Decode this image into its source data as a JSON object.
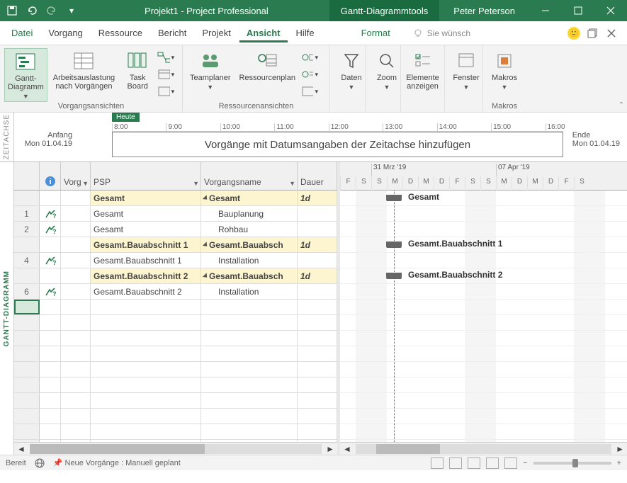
{
  "titlebar": {
    "title": "Projekt1  -  Project Professional",
    "tools": "Gantt-Diagrammtools",
    "user": "Peter Peterson"
  },
  "menu": {
    "file": "Datei",
    "vorgang": "Vorgang",
    "ressource": "Ressource",
    "bericht": "Bericht",
    "projekt": "Projekt",
    "ansicht": "Ansicht",
    "hilfe": "Hilfe",
    "format": "Format",
    "tellme": "Sie wünsch"
  },
  "ribbon": {
    "gantt": "Gantt-\nDiagramm",
    "arbeit": "Arbeitsauslastung\nnach Vorgängen",
    "task": "Task\nBoard",
    "group1": "Vorgangsansichten",
    "team": "Teamplaner",
    "resplan": "Ressourcenplan",
    "group2": "Ressourcenansichten",
    "daten": "Daten",
    "zoom": "Zoom",
    "elemente": "Elemente\nanzeigen",
    "fenster": "Fenster",
    "makros": "Makros",
    "group3": "Makros"
  },
  "timeline": {
    "heute": "Heute",
    "anfang": "Anfang",
    "anfang_date": "Mon 01.04.19",
    "ende": "Ende",
    "ende_date": "Mon 01.04.19",
    "prompt": "Vorgänge mit Datumsangaben der Zeitachse hinzufügen",
    "ticks": [
      "8:00",
      "9:00",
      "10:00",
      "11:00",
      "12:00",
      "13:00",
      "14:00",
      "15:00",
      "16:00"
    ]
  },
  "vtab_timeline": "ZEITACHSE",
  "vtab_gantt": "GANTT-DIAGRAMM",
  "columns": {
    "info": "",
    "vorg": "Vorg",
    "psp": "PSP",
    "name": "Vorgangsname",
    "dauer": "Dauer"
  },
  "rows": [
    {
      "num": "",
      "summary": true,
      "psp": "Gesamt",
      "name": "Gesamt",
      "dauer": "1d",
      "bar": "Gesamt"
    },
    {
      "num": "1",
      "summary": false,
      "psp": "Gesamt",
      "name": "Bauplanung",
      "dauer": "",
      "icon": true
    },
    {
      "num": "2",
      "summary": false,
      "psp": "Gesamt",
      "name": "Rohbau",
      "dauer": "",
      "icon": true
    },
    {
      "num": "",
      "summary": true,
      "psp": "Gesamt.Bauabschnitt 1",
      "name": "Gesamt.Bauabsch",
      "dauer": "1d",
      "bar": "Gesamt.Bauabschnitt 1"
    },
    {
      "num": "4",
      "summary": false,
      "psp": "Gesamt.Bauabschnitt 1",
      "name": "Installation",
      "dauer": "",
      "icon": true
    },
    {
      "num": "",
      "summary": true,
      "psp": "Gesamt.Bauabschnitt 2",
      "name": "Gesamt.Bauabsch",
      "dauer": "1d",
      "bar": "Gesamt.Bauabschnitt 2"
    },
    {
      "num": "6",
      "summary": false,
      "psp": "Gesamt.Bauabschnitt 2",
      "name": "Installation",
      "dauer": "",
      "icon": true
    }
  ],
  "chart": {
    "week1": "31 Mrz '19",
    "week2": "07 Apr '19",
    "days": [
      "F",
      "S",
      "S",
      "M",
      "D",
      "M",
      "D",
      "F",
      "S",
      "S",
      "M",
      "D",
      "M",
      "D",
      "F",
      "S"
    ]
  },
  "status": {
    "ready": "Bereit",
    "neuv": "Neue Vorgänge : Manuell geplant"
  }
}
